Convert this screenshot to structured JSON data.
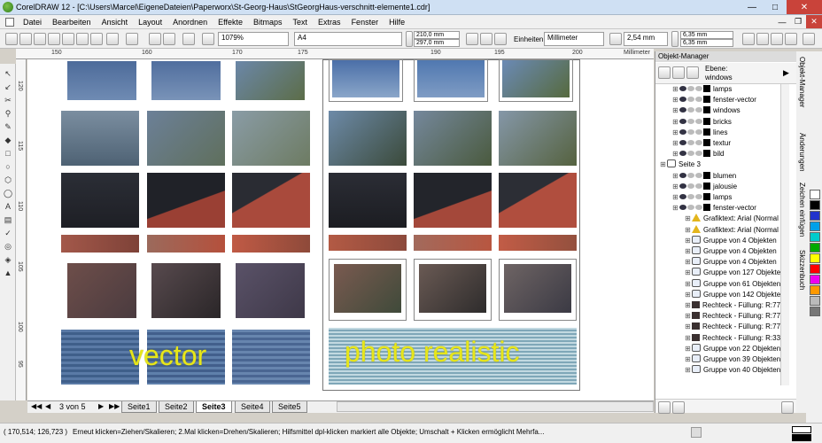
{
  "window": {
    "title": "CorelDRAW 12 - [C:\\Users\\Marcel\\EigeneDateien\\Paperworx\\St-Georg-Haus\\StGeorgHaus-verschnitt-elemente1.cdr]"
  },
  "menu": [
    "Datei",
    "Bearbeiten",
    "Ansicht",
    "Layout",
    "Anordnen",
    "Effekte",
    "Bitmaps",
    "Text",
    "Extras",
    "Fenster",
    "Hilfe"
  ],
  "toolbar": {
    "zoom": "1079%",
    "page_size": "A4",
    "width": "210,0 mm",
    "height": "297,0 mm",
    "units_label": "Einheiten:",
    "units_value": "Millimeter",
    "nudge": "2,54 mm",
    "dup_x": "6,35 mm",
    "dup_y": "6,35 mm"
  },
  "ruler": {
    "h_ticks": [
      "150",
      "160",
      "170",
      "175",
      "190",
      "195",
      "200",
      "Millimeter"
    ],
    "v_ticks": [
      "120",
      "115",
      "110",
      "105",
      "100",
      "95",
      "Millimeter"
    ]
  },
  "canvas": {
    "label_left": "vector",
    "label_right": "photo realistic"
  },
  "pagetabs": {
    "counter": "3 von 5",
    "tabs": [
      "Seite1",
      "Seite2",
      "Seite3",
      "Seite4",
      "Seite5"
    ],
    "active": "Seite3"
  },
  "status": {
    "coords": "( 170,514; 126,723 )",
    "hint": "Erneut klicken=Ziehen/Skalieren; 2.Mal klicken=Drehen/Skalieren; Hilfsmittel dpl-klicken markiert alle Objekte; Umschalt + Klicken ermöglicht Mehrfa..."
  },
  "panel": {
    "title": "Objekt-Manager",
    "layer_label": "Ebene:",
    "layer_value": "windows",
    "rows": [
      {
        "kind": "layer",
        "label": "lamps",
        "indent": 1
      },
      {
        "kind": "layer",
        "label": "fenster-vector",
        "indent": 1
      },
      {
        "kind": "layer",
        "label": "windows",
        "indent": 1
      },
      {
        "kind": "layer",
        "label": "bricks",
        "indent": 1
      },
      {
        "kind": "layer",
        "label": "lines",
        "indent": 1
      },
      {
        "kind": "layer",
        "label": "textur",
        "indent": 1
      },
      {
        "kind": "layer",
        "label": "bild",
        "indent": 1
      },
      {
        "kind": "page",
        "label": "Seite 3",
        "indent": 0
      },
      {
        "kind": "layer",
        "label": "blumen",
        "indent": 1
      },
      {
        "kind": "layer",
        "label": "jalousie",
        "indent": 1
      },
      {
        "kind": "layer",
        "label": "lamps",
        "indent": 1
      },
      {
        "kind": "layer",
        "label": "fenster-vector",
        "indent": 1
      },
      {
        "kind": "warn",
        "label": "Grafiktext: Arial (Normal",
        "indent": 2
      },
      {
        "kind": "warn",
        "label": "Grafiktext: Arial (Normal",
        "indent": 2
      },
      {
        "kind": "group",
        "label": "Gruppe von 4 Objekten",
        "indent": 2
      },
      {
        "kind": "group",
        "label": "Gruppe von 4 Objekten",
        "indent": 2
      },
      {
        "kind": "group",
        "label": "Gruppe von 4 Objekten",
        "indent": 2
      },
      {
        "kind": "group",
        "label": "Gruppe von 127 Objekten",
        "indent": 2
      },
      {
        "kind": "group",
        "label": "Gruppe von 61 Objekten",
        "indent": 2
      },
      {
        "kind": "group",
        "label": "Gruppe von 142 Objekten",
        "indent": 2
      },
      {
        "kind": "rect",
        "label": "Rechteck - Füllung: R:77",
        "indent": 2
      },
      {
        "kind": "rect",
        "label": "Rechteck - Füllung: R:77",
        "indent": 2
      },
      {
        "kind": "rect",
        "label": "Rechteck - Füllung: R:77",
        "indent": 2
      },
      {
        "kind": "rect",
        "label": "Rechteck - Füllung: R:33",
        "indent": 2
      },
      {
        "kind": "group",
        "label": "Gruppe von 22 Objekten",
        "indent": 2
      },
      {
        "kind": "group",
        "label": "Gruppe von 39 Objekten",
        "indent": 2
      },
      {
        "kind": "group",
        "label": "Gruppe von 40 Objekten",
        "indent": 2
      }
    ]
  },
  "dockers": [
    "Objekt-Manager",
    "Änderungen",
    "Zeichen einfügen",
    "Skizzenbuch"
  ],
  "palette": [
    "#ffffff",
    "#000000",
    "#2233cc",
    "#00a0e8",
    "#00cccc",
    "#00aa00",
    "#ffff00",
    "#ff0000",
    "#ee00ee",
    "#ff9900",
    "#bbbbbb",
    "#777777"
  ]
}
